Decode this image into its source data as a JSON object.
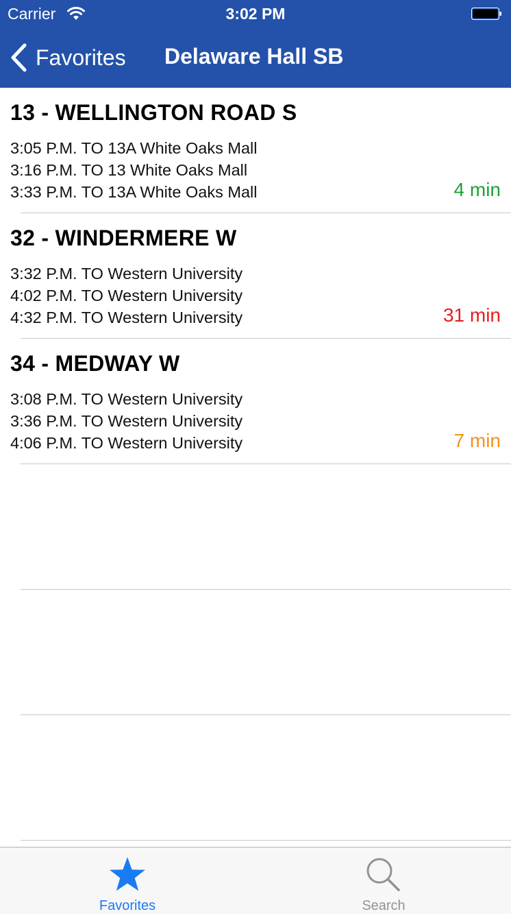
{
  "status_bar": {
    "carrier": "Carrier",
    "time": "3:02 PM"
  },
  "nav": {
    "back_label": "Favorites",
    "title": "Delaware Hall SB"
  },
  "colors": {
    "header": "#2452ab",
    "accent": "#1a7bf2",
    "eta_green": "#1aa232",
    "eta_red": "#e61e1e",
    "eta_orange": "#f5901e"
  },
  "routes": [
    {
      "title": "13 - WELLINGTON ROAD S",
      "departures": [
        "3:05 P.M. TO 13A White Oaks Mall",
        "3:16 P.M. TO 13 White Oaks Mall",
        "3:33 P.M. TO 13A White Oaks Mall"
      ],
      "eta": "4 min",
      "eta_color": "#1aa232"
    },
    {
      "title": "32 - WINDERMERE W",
      "departures": [
        "3:32 P.M. TO Western University",
        "4:02 P.M. TO Western University",
        "4:32 P.M. TO Western University"
      ],
      "eta": "31 min",
      "eta_color": "#e61e1e"
    },
    {
      "title": "34 - MEDWAY W",
      "departures": [
        "3:08 P.M. TO Western University",
        "3:36 P.M. TO Western University",
        "4:06 P.M. TO Western University"
      ],
      "eta": "7 min",
      "eta_color": "#f5901e"
    }
  ],
  "tabs": [
    {
      "label": "Favorites",
      "icon": "star-icon",
      "selected": true
    },
    {
      "label": "Search",
      "icon": "magnifier-icon",
      "selected": false
    }
  ]
}
